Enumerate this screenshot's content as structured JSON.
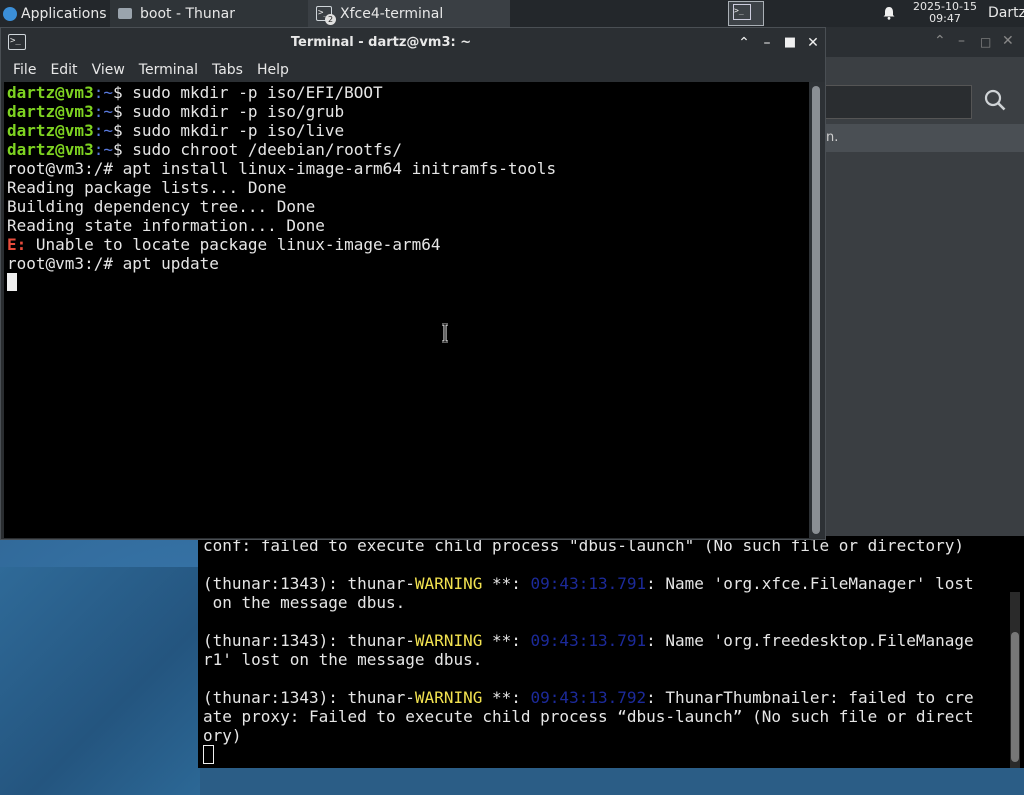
{
  "panel": {
    "applications_label": "Applications",
    "tasks": [
      {
        "label": "boot - Thunar"
      },
      {
        "label": "Xfce4-terminal",
        "badge": "2"
      }
    ],
    "clock_date": "2025-10-15",
    "clock_time": "09:47",
    "user": "Dartz"
  },
  "terminal": {
    "title": "Terminal - dartz@vm3: ~",
    "menu": [
      "File",
      "Edit",
      "View",
      "Terminal",
      "Tabs",
      "Help"
    ],
    "prompt_user": "dartz@vm3",
    "prompt_path": ":~",
    "prompt_symbol": "$ ",
    "commands": [
      "sudo mkdir -p iso/EFI/BOOT",
      "sudo mkdir -p iso/grub",
      "sudo mkdir -p iso/live",
      "sudo chroot /deebian/rootfs/"
    ],
    "root_prompt": "root@vm3:/# ",
    "root_cmd1": "apt install linux-image-arm64 initramfs-tools",
    "out1": "Reading package lists... Done",
    "out2": "Building dependency tree... Done",
    "out3": "Reading state information... Done",
    "err_prefix": "E:",
    "err_msg": " Unable to locate package linux-image-arm64",
    "root_cmd2": "apt update"
  },
  "back_terminal": {
    "line0": "conf: failed to execute child process \"dbus-launch\" (No such file or directory)",
    "thunar_prefix": "(thunar:1343): thunar-",
    "warn_word": "WARNING",
    "stars": " **: ",
    "ts1": "09:43:13.791",
    "msg1a": ": Name 'org.xfce.FileManager' lost",
    "msg1b": " on the message dbus.",
    "ts2": "09:43:13.791",
    "msg2a": ": Name 'org.freedesktop.FileManage",
    "msg2b": "r1' lost on the message dbus.",
    "ts3": "09:43:13.792",
    "msg3a": ": ThunarThumbnailer: failed to cre",
    "msg3b": "ate proxy: Failed to execute child process “dbus-launch” (No such file or direct",
    "msg3c": "ory)"
  },
  "thunar_window": {
    "infobar_text": "n."
  },
  "icons": [
    "xfce-menu-icon",
    "folder-icon",
    "terminal-icon",
    "workspace-icon",
    "bell-icon",
    "search-icon",
    "minimize-icon",
    "maximize-icon",
    "close-icon",
    "shade-icon"
  ]
}
